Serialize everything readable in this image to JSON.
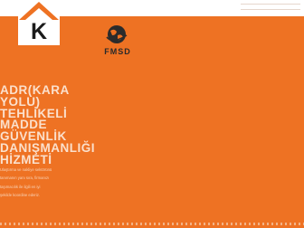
{
  "header": {
    "brand_letter": "K",
    "partner_logo_text": "FMSD",
    "brand_logo_icon": "house-roof-icon",
    "partner_logo_icon": "globe-icon",
    "nav_icon": "menu-lines-icon"
  },
  "hero": {
    "title_lines": [
      "ADR(KARA",
      "YOLU)",
      "TEHLİKELİ",
      "MADDE",
      "GÜVENLİK",
      "DANIŞMANLIĞI",
      "HİZMETİ"
    ],
    "description_lines": [
      "Ulaştırma ve nakliye sektörünü",
      "tanımanın yanı sıra, firmanızı",
      "taşımacılık ile ilgili en iyi",
      "şekilde koordine ederiz."
    ]
  },
  "colors": {
    "background": "#ee7223",
    "header": "#ffffff",
    "logo_roof": "#ee7223",
    "title_text": "#fbe0cc"
  }
}
